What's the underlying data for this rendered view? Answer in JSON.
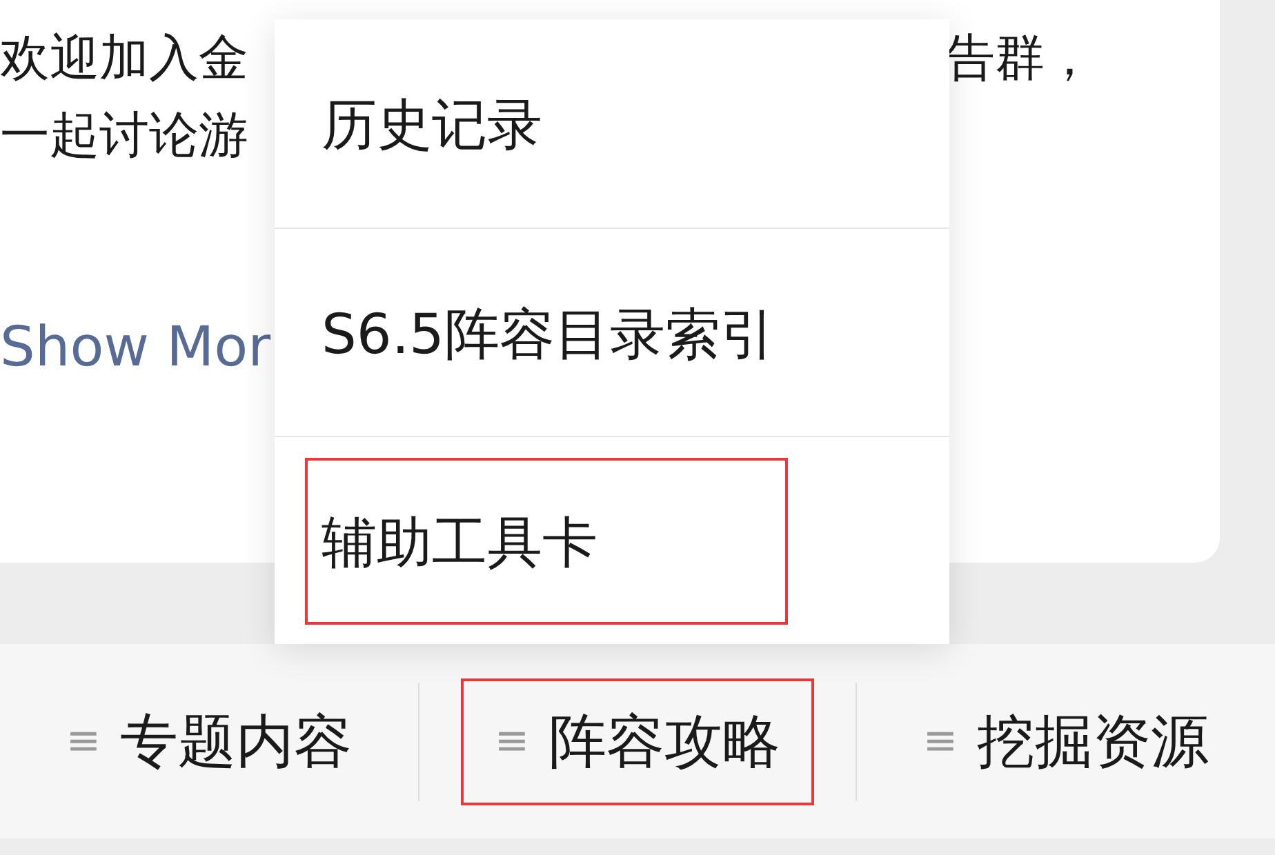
{
  "intro": {
    "lines": [
      {
        "left": "欢迎加入金",
        "right": "告群，"
      },
      {
        "left": "一起讨论游"
      }
    ],
    "link": "Show Mor"
  },
  "menu": {
    "items": [
      {
        "label": "历史记录",
        "highlighted": false
      },
      {
        "label": "S6.5阵容目录索引",
        "highlighted": false
      },
      {
        "label": "辅助工具卡",
        "highlighted": true
      }
    ]
  },
  "tabs": [
    {
      "label": "专题内容",
      "icon": "≡",
      "highlighted": false
    },
    {
      "label": "阵容攻略",
      "icon": "≡",
      "highlighted": true
    },
    {
      "label": "挖掘资源",
      "icon": "≡",
      "highlighted": false
    }
  ]
}
